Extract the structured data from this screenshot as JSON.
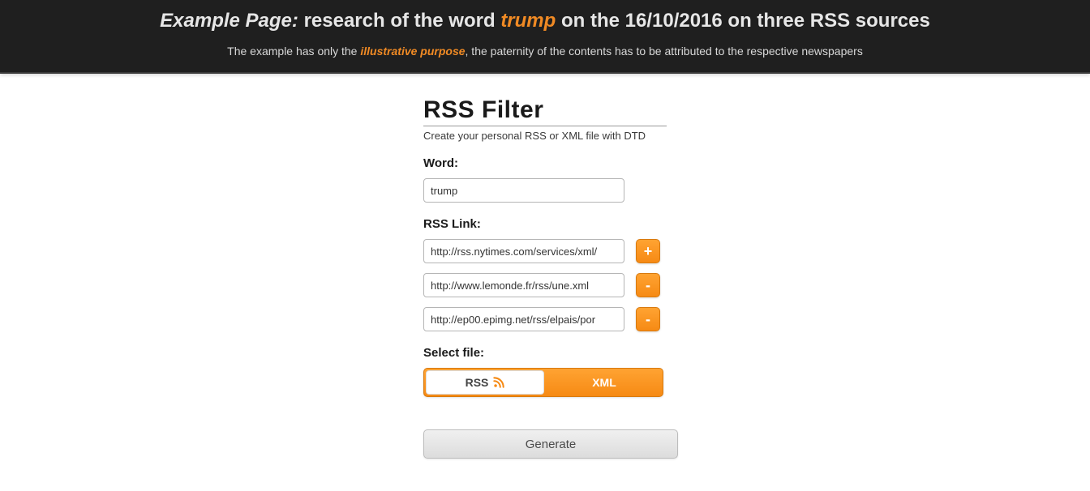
{
  "banner": {
    "prefix": "Example Page:",
    "text_before": " research of the word ",
    "keyword": "trump",
    "text_after": " on the 16/10/2016 on three RSS sources",
    "sub_before": "The example has only the ",
    "sub_em": "illustrative purpose",
    "sub_after": ", the paternity of the contents has to be attributed to the respective newspapers"
  },
  "app": {
    "title": "RSS Filter",
    "subtitle": "Create your personal RSS or XML file with DTD"
  },
  "form": {
    "word_label": "Word:",
    "word_value": "trump",
    "link_label": "RSS Link:",
    "links": [
      "http://rss.nytimes.com/services/xml/",
      "http://www.lemonde.fr/rss/une.xml",
      "http://ep00.epimg.net/rss/elpais/por"
    ],
    "add_label": "+",
    "remove_label": "-",
    "select_label": "Select file:",
    "seg_rss": "RSS",
    "seg_xml": "XML",
    "generate": "Generate"
  },
  "colors": {
    "accent": "#f68a14"
  }
}
